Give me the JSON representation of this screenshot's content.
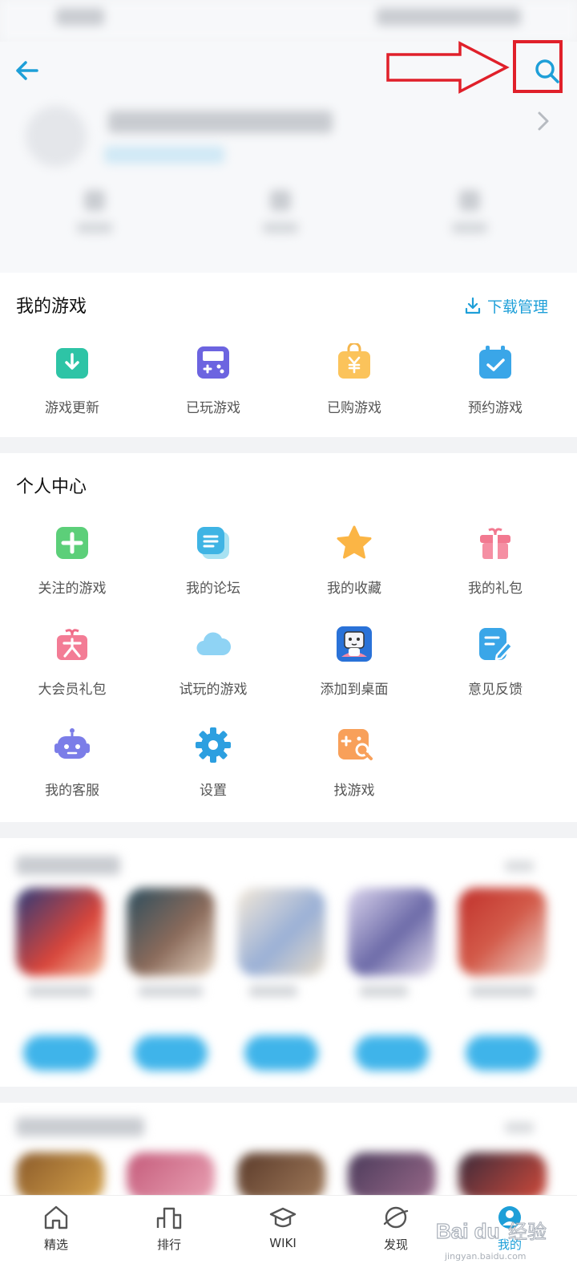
{
  "my_games": {
    "title": "我的游戏",
    "download_manage": "下载管理",
    "items": [
      {
        "label": "游戏更新",
        "icon": "download-update-icon"
      },
      {
        "label": "已玩游戏",
        "icon": "gamepad-icon"
      },
      {
        "label": "已购游戏",
        "icon": "purchased-bag-icon"
      },
      {
        "label": "预约游戏",
        "icon": "calendar-check-icon"
      }
    ]
  },
  "personal_center": {
    "title": "个人中心",
    "items": [
      {
        "label": "关注的游戏",
        "icon": "plus-follow-icon"
      },
      {
        "label": "我的论坛",
        "icon": "forum-icon"
      },
      {
        "label": "我的收藏",
        "icon": "star-icon"
      },
      {
        "label": "我的礼包",
        "icon": "gift-icon"
      },
      {
        "label": "大会员礼包",
        "icon": "vip-gift-icon"
      },
      {
        "label": "试玩的游戏",
        "icon": "cloud-icon"
      },
      {
        "label": "添加到桌面",
        "icon": "tv-mascot-icon"
      },
      {
        "label": "意见反馈",
        "icon": "feedback-edit-icon"
      },
      {
        "label": "我的客服",
        "icon": "robot-service-icon"
      },
      {
        "label": "设置",
        "icon": "gear-icon"
      },
      {
        "label": "找游戏",
        "icon": "find-game-icon"
      }
    ]
  },
  "tabbar": {
    "items": [
      {
        "label": "精选",
        "icon": "home-icon"
      },
      {
        "label": "排行",
        "icon": "ranking-icon"
      },
      {
        "label": "WIKI",
        "icon": "graduation-cap-icon"
      },
      {
        "label": "发现",
        "icon": "planet-icon"
      },
      {
        "label": "我的",
        "icon": "profile-icon",
        "active": true
      }
    ]
  },
  "watermark": {
    "brand": "Baidu经验",
    "url": "jingyan.baidu.com"
  },
  "colors": {
    "accent": "#1e9fd8",
    "annotation": "#e0202a"
  }
}
